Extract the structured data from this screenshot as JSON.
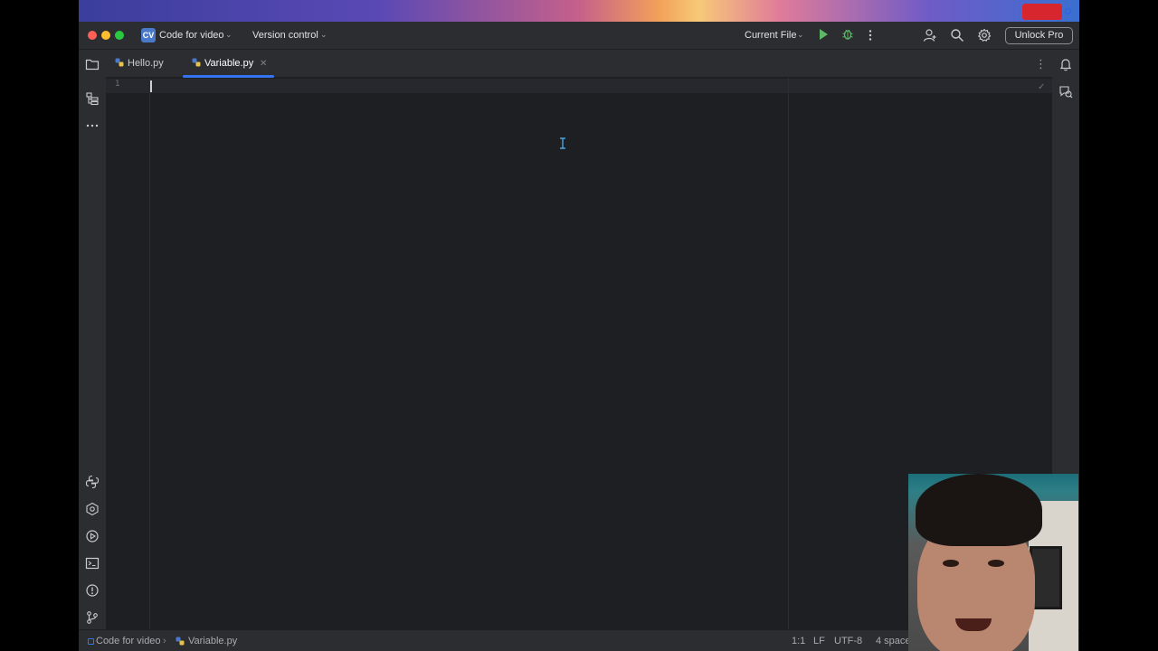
{
  "window": {
    "project_badge": "CV",
    "project_name": "Code for video",
    "vcs_label": "Version control",
    "run_config": "Current File",
    "unlock_label": "Unlock Pro"
  },
  "tabs": [
    {
      "label": "Hello.py",
      "active": false
    },
    {
      "label": "Variable.py",
      "active": true
    }
  ],
  "editor": {
    "line_numbers": [
      "1"
    ]
  },
  "statusbar": {
    "breadcrumb_project": "Code for video",
    "breadcrumb_file": "Variable.py",
    "position": "1:1",
    "line_ending": "LF",
    "encoding": "UTF-8",
    "indent": "4 space"
  },
  "colors": {
    "accent": "#3574f0",
    "run_green": "#5fb865",
    "bg": "#1e1f22",
    "panel": "#2b2d30"
  },
  "icons": {
    "left_top": [
      "folder-icon",
      "structure-icon",
      "more-icon"
    ],
    "left_bottom": [
      "python-packages-icon",
      "python-console-icon",
      "services-icon",
      "terminal-icon",
      "problems-icon",
      "git-icon"
    ],
    "right": [
      "notifications-icon",
      "ai-assistant-icon"
    ]
  }
}
